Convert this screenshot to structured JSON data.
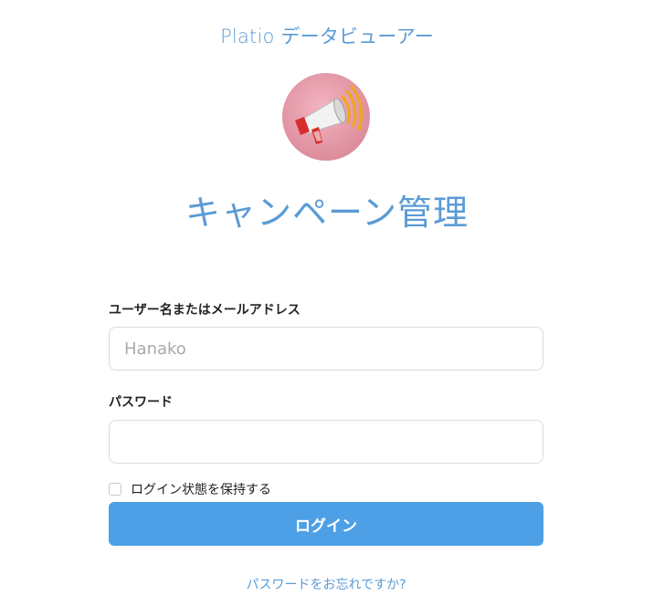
{
  "header": {
    "app_title": "Platio データビューアー",
    "page_title": "キャンペーン管理",
    "logo_icon": "megaphone-icon"
  },
  "login_form": {
    "username_label": "ユーザー名またはメールアドレス",
    "username_placeholder": "Hanako",
    "username_value": "",
    "password_label": "パスワード",
    "password_value": "",
    "remember_label": "ログイン状態を保持する",
    "remember_checked": false,
    "submit_label": "ログイン",
    "forgot_link": "パスワードをお忘れですか?"
  },
  "colors": {
    "accent": "#5b9bd5",
    "button": "#4da0e6",
    "logo_bg": "#e39aa8",
    "megaphone_red": "#d62e2e"
  }
}
